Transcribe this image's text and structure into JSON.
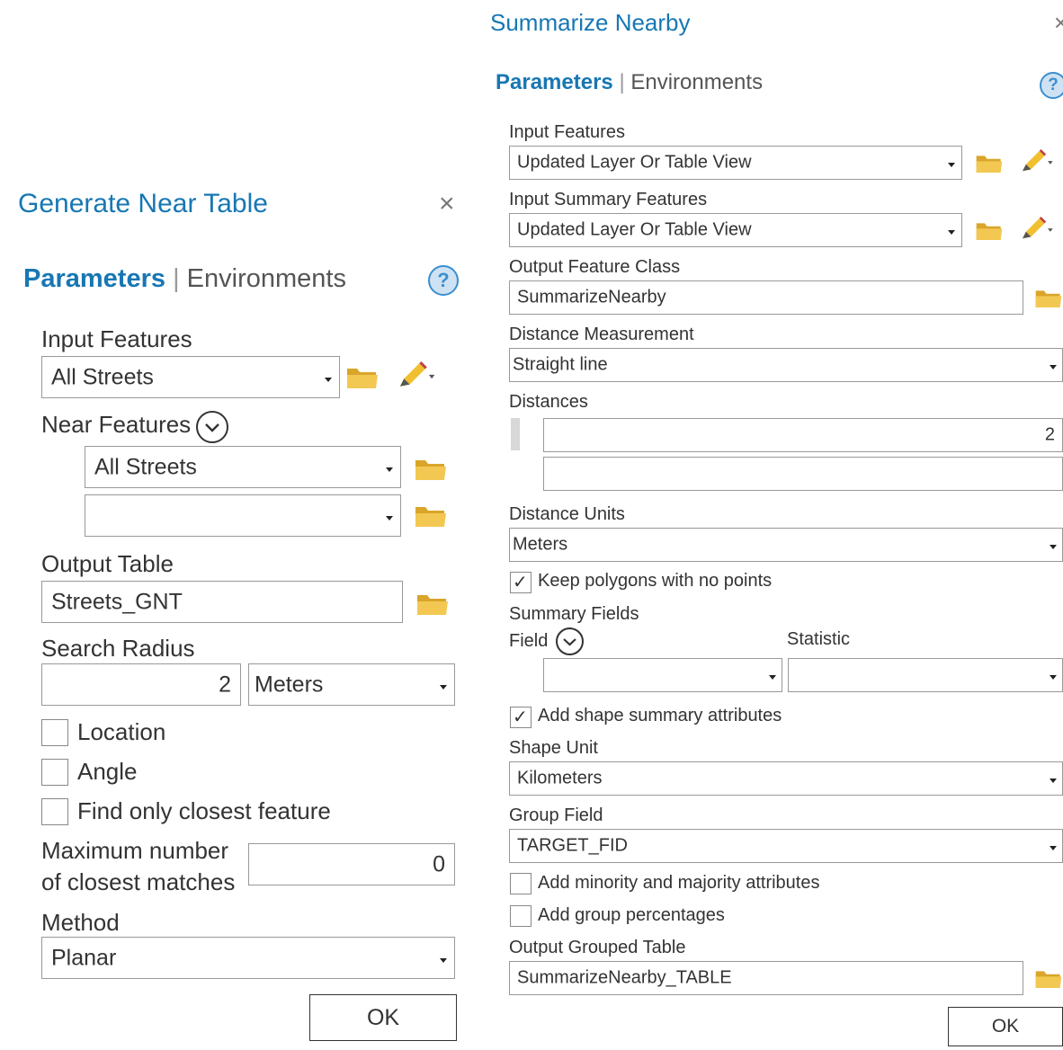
{
  "gnt": {
    "title": "Generate Near Table",
    "tab_params": "Parameters",
    "tab_env": "Environments",
    "input_features_label": "Input Features",
    "input_features_value": "All Streets",
    "near_features_label": "Near Features",
    "near_features_rows": [
      "All Streets",
      ""
    ],
    "output_table_label": "Output Table",
    "output_table_value": "Streets_GNT",
    "search_radius_label": "Search Radius",
    "search_radius_value": "2",
    "search_radius_unit": "Meters",
    "location_label": "Location",
    "angle_label": "Angle",
    "closest_label": "Find only closest feature",
    "max_matches_label_1": "Maximum number",
    "max_matches_label_2": "of closest matches",
    "max_matches_value": "0",
    "method_label": "Method",
    "method_value": "Planar",
    "ok_label": "OK"
  },
  "sn": {
    "title": "Summarize Nearby",
    "tab_params": "Parameters",
    "tab_env": "Environments",
    "input_features_label": "Input Features",
    "input_features_value": "Updated Layer Or Table View",
    "input_summary_label": "Input Summary Features",
    "input_summary_value": "Updated Layer Or Table View",
    "output_fc_label": "Output Feature Class",
    "output_fc_value": "SummarizeNearby",
    "distance_measurement_label": "Distance Measurement",
    "distance_measurement_value": "Straight line",
    "distances_label": "Distances",
    "distances_rows": [
      "2",
      ""
    ],
    "distance_units_label": "Distance Units",
    "distance_units_value": "Meters",
    "keep_polygons_label": "Keep polygons with no points",
    "summary_fields_label": "Summary Fields",
    "field_label": "Field",
    "statistic_label": "Statistic",
    "field_value": "",
    "statistic_value": "",
    "shape_summary_label": "Add shape summary attributes",
    "shape_unit_label": "Shape Unit",
    "shape_unit_value": "Kilometers",
    "group_field_label": "Group Field",
    "group_field_value": "TARGET_FID",
    "minority_label": "Add minority and majority attributes",
    "group_pct_label": "Add group percentages",
    "output_grouped_label": "Output Grouped Table",
    "output_grouped_value": "SummarizeNearby_TABLE",
    "ok_label": "OK"
  },
  "icons": {
    "close": "×",
    "help": "?",
    "check": "✓"
  },
  "colors": {
    "accent": "#1777b3",
    "folder": "#e8b93a",
    "pencil": "#e3b21f"
  }
}
